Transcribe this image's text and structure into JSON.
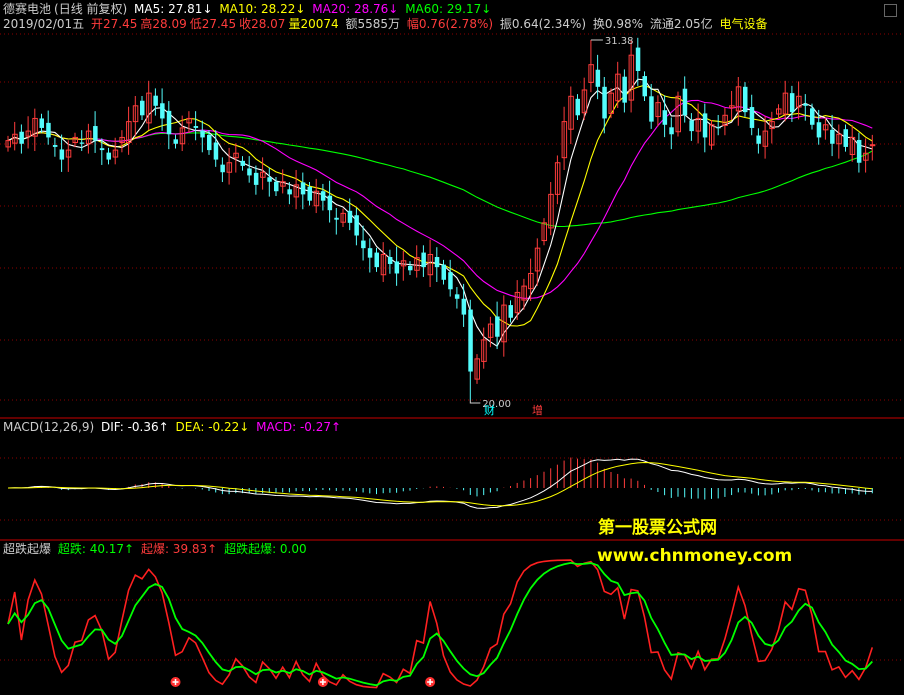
{
  "header": {
    "stock_name": "德赛电池",
    "period": "(日线 前复权)",
    "ma5_label": "MA5: 27.81↓",
    "ma10_label": "MA10: 28.22↓",
    "ma20_label": "MA20: 28.76↓",
    "ma60_label": "MA60: 29.17↓",
    "date": "2019/02/01五",
    "open": "开27.45",
    "high": "高28.09",
    "low": "低27.45",
    "close": "收28.07",
    "volume": "量20074",
    "amount": "额5585万",
    "change": "幅0.76(2.78%)",
    "amplitude": "振0.64(2.34%)",
    "turnover": "换0.98%",
    "float": "流通2.05亿",
    "industry": "电气设备"
  },
  "price_panel": {
    "high_marker": "31.38",
    "low_marker": "20.00",
    "event_labels": [
      "财",
      "增"
    ]
  },
  "macd_panel": {
    "title": "MACD(12,26,9)",
    "dif": "DIF: -0.36↑",
    "dea": "DEA: -0.22↓",
    "macd": "MACD: -0.27↑"
  },
  "indicator_panel": {
    "title": "超跌起爆",
    "chaodie": "超跌: 40.17↑",
    "qibao": "起爆: 39.83↑",
    "chaodie_qibao": "超跌起爆: 0.00"
  },
  "watermark": {
    "line1": "第一股票公式网",
    "line2": "www.chnmoney.com"
  },
  "colors": {
    "up": "#ff3c3c",
    "down": "#54fcfc",
    "ma5": "#ffffff",
    "ma10": "#ffff00",
    "ma20": "#ff00ff",
    "ma60": "#00ff00",
    "grid": "#8b0000",
    "watermark": "#ffff00"
  },
  "chart_data": [
    {
      "type": "candlestick",
      "title": "德赛电池 (日线 前复权)",
      "ylim": [
        20.0,
        31.38
      ],
      "annotations": [
        {
          "label": "31.38",
          "kind": "high"
        },
        {
          "label": "20.00",
          "kind": "low"
        }
      ],
      "close": [
        28.2,
        28.4,
        28.1,
        28.5,
        28.9,
        28.6,
        28.3,
        28.0,
        27.6,
        27.9,
        28.3,
        28.1,
        28.5,
        28.2,
        27.9,
        27.6,
        27.9,
        28.3,
        28.8,
        29.3,
        29.0,
        29.7,
        29.3,
        28.9,
        28.4,
        28.1,
        28.6,
        28.9,
        28.6,
        28.3,
        27.9,
        27.6,
        27.2,
        27.5,
        27.8,
        27.4,
        27.1,
        26.8,
        27.2,
        26.9,
        26.6,
        26.9,
        26.5,
        26.8,
        26.5,
        26.3,
        26.6,
        26.3,
        26.0,
        25.7,
        25.9,
        25.6,
        25.2,
        24.8,
        24.5,
        24.2,
        24.6,
        24.3,
        24.0,
        24.4,
        24.1,
        24.5,
        24.2,
        24.6,
        24.2,
        23.8,
        23.5,
        23.2,
        22.7,
        20.9,
        21.3,
        21.9,
        22.4,
        22.0,
        23.0,
        22.6,
        23.4,
        23.6,
        24.0,
        24.8,
        25.6,
        26.5,
        27.5,
        28.8,
        29.6,
        29.0,
        29.8,
        30.6,
        29.9,
        28.9,
        29.7,
        30.3,
        29.4,
        30.9,
        30.4,
        29.6,
        28.8,
        29.4,
        28.7,
        28.4,
        29.6,
        29.0,
        28.5,
        28.9,
        28.3,
        28.7,
        28.6,
        29.0,
        29.3,
        29.9,
        29.1,
        28.6,
        28.1,
        28.5,
        28.8,
        29.2,
        29.7,
        29.1,
        29.6,
        29.3,
        28.7,
        28.3,
        28.7,
        28.1,
        28.4,
        28.0,
        28.3,
        27.5,
        27.8,
        28.07
      ],
      "ma_series": [
        {
          "name": "MA5",
          "last": 27.81
        },
        {
          "name": "MA10",
          "last": 28.22
        },
        {
          "name": "MA20",
          "last": 28.76
        },
        {
          "name": "MA60",
          "last": 29.17
        }
      ]
    },
    {
      "type": "bar",
      "title": "MACD(12,26,9)",
      "series": [
        {
          "name": "DIF",
          "last": -0.36
        },
        {
          "name": "DEA",
          "last": -0.22
        },
        {
          "name": "MACD",
          "last": -0.27
        }
      ]
    },
    {
      "type": "line",
      "title": "超跌起爆",
      "series": [
        {
          "name": "超跌",
          "last": 40.17
        },
        {
          "name": "起爆",
          "last": 39.83
        },
        {
          "name": "超跌起爆",
          "last": 0.0
        }
      ]
    }
  ]
}
